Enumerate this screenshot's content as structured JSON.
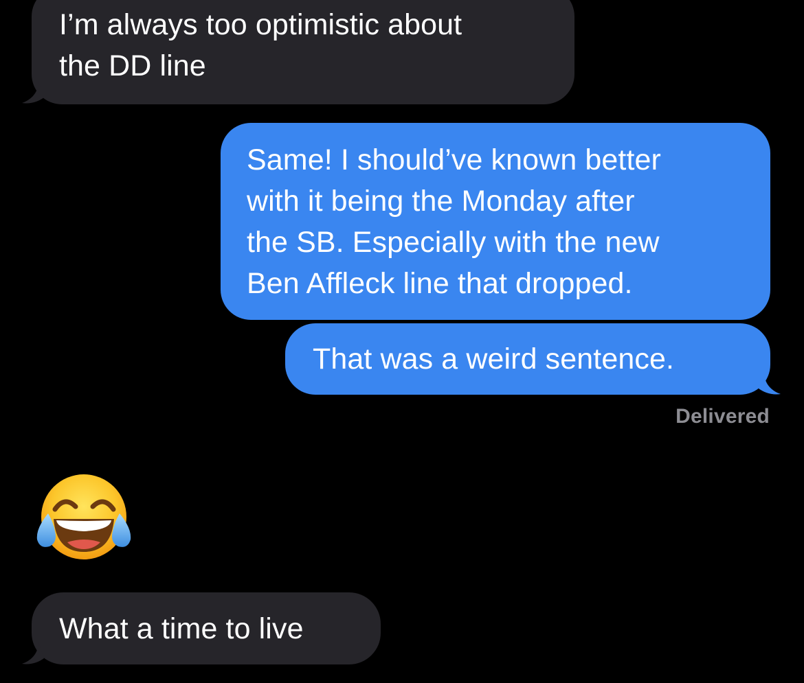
{
  "messages": [
    {
      "direction": "incoming",
      "lines": [
        "I’m always too optimistic about",
        "the DD line"
      ]
    },
    {
      "direction": "outgoing",
      "lines": [
        "Same! I should’ve known better",
        "with it being the Monday after",
        "the SB. Especially with the new",
        "Ben Affleck line that dropped."
      ]
    },
    {
      "direction": "outgoing",
      "lines": [
        "That was a weird sentence."
      ]
    },
    {
      "direction": "incoming",
      "lines": [
        "What a time to live"
      ]
    }
  ],
  "status": {
    "delivered": "Delivered"
  },
  "reaction_emoji": {
    "icon": "face-with-tears-of-joy-icon"
  },
  "colors": {
    "background": "#000000",
    "incoming_bubble": "#26252a",
    "outgoing_bubble": "#3a86f0",
    "status_text": "#8d8d93"
  }
}
